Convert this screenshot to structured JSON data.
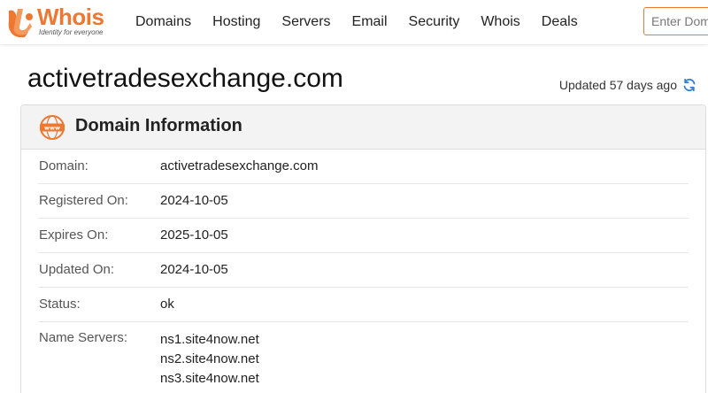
{
  "brand": {
    "name": "Whois",
    "tagline": "Identity for everyone",
    "accent": "#ee7832"
  },
  "nav": {
    "items": [
      {
        "label": "Domains"
      },
      {
        "label": "Hosting"
      },
      {
        "label": "Servers"
      },
      {
        "label": "Email"
      },
      {
        "label": "Security"
      },
      {
        "label": "Whois"
      },
      {
        "label": "Deals"
      }
    ]
  },
  "search": {
    "placeholder": "Enter Domain or IP",
    "value": ""
  },
  "page": {
    "title": "activetradesexchange.com",
    "updated_text": "Updated 57 days ago",
    "refresh_icon": "refresh-icon"
  },
  "domain_info": {
    "heading": "Domain Information",
    "icon": "www-icon",
    "rows": [
      {
        "label": "Domain:",
        "value": "activetradesexchange.com"
      },
      {
        "label": "Registered On:",
        "value": "2024-10-05"
      },
      {
        "label": "Expires On:",
        "value": "2025-10-05"
      },
      {
        "label": "Updated On:",
        "value": "2024-10-05"
      },
      {
        "label": "Status:",
        "value": "ok"
      }
    ],
    "name_servers": {
      "label": "Name Servers:",
      "values": [
        "ns1.site4now.net",
        "ns2.site4now.net",
        "ns3.site4now.net"
      ]
    }
  }
}
